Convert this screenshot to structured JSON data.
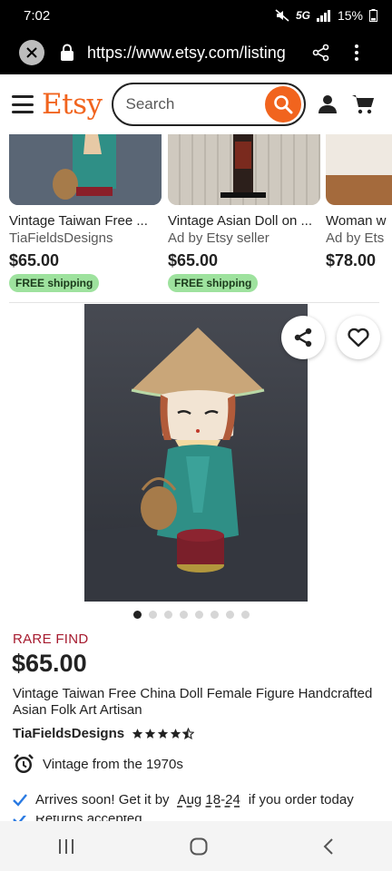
{
  "status_bar": {
    "time": "7:02",
    "network": "5G",
    "battery": "15%"
  },
  "browser": {
    "url": "https://www.etsy.com/listing"
  },
  "header": {
    "logo": "Etsy",
    "search_placeholder": "Search"
  },
  "recommendations": [
    {
      "title": "Vintage Taiwan Free ...",
      "shop": "TiaFieldsDesigns",
      "price": "$65.00",
      "badge": "FREE shipping"
    },
    {
      "title": "Vintage Asian Doll on ...",
      "shop": "Ad by Etsy seller",
      "price": "$65.00",
      "badge": "FREE shipping"
    },
    {
      "title": "Woman w",
      "shop": "Ad by Ets",
      "price": "$78.00",
      "badge": ""
    }
  ],
  "gallery": {
    "image_count": 8,
    "active_index": 0
  },
  "listing": {
    "rare_find": "RARE FIND",
    "price": "$65.00",
    "title": "Vintage Taiwan Free China Doll Female Figure Handcrafted Asian Folk Art Artisan",
    "shop_name": "TiaFieldsDesigns",
    "rating": 4.5,
    "vintage": "Vintage from the 1970s",
    "arrives_prefix": "Arrives soon! Get it by",
    "arrives_date": "Aug 18-24",
    "arrives_suffix": "if you order today",
    "partial_text": "Returns accepted"
  },
  "colors": {
    "brand": "#f1641e",
    "rare": "#a61a2e",
    "shipping_badge": "#9ee29e",
    "check": "#2a7ae2"
  },
  "icons": [
    "close-icon",
    "lock-icon",
    "share-icon",
    "more-icon",
    "hamburger-icon",
    "search-icon",
    "user-icon",
    "cart-icon",
    "heart-icon",
    "alarm-clock-icon",
    "check-icon",
    "recents-icon",
    "home-icon",
    "back-icon"
  ]
}
